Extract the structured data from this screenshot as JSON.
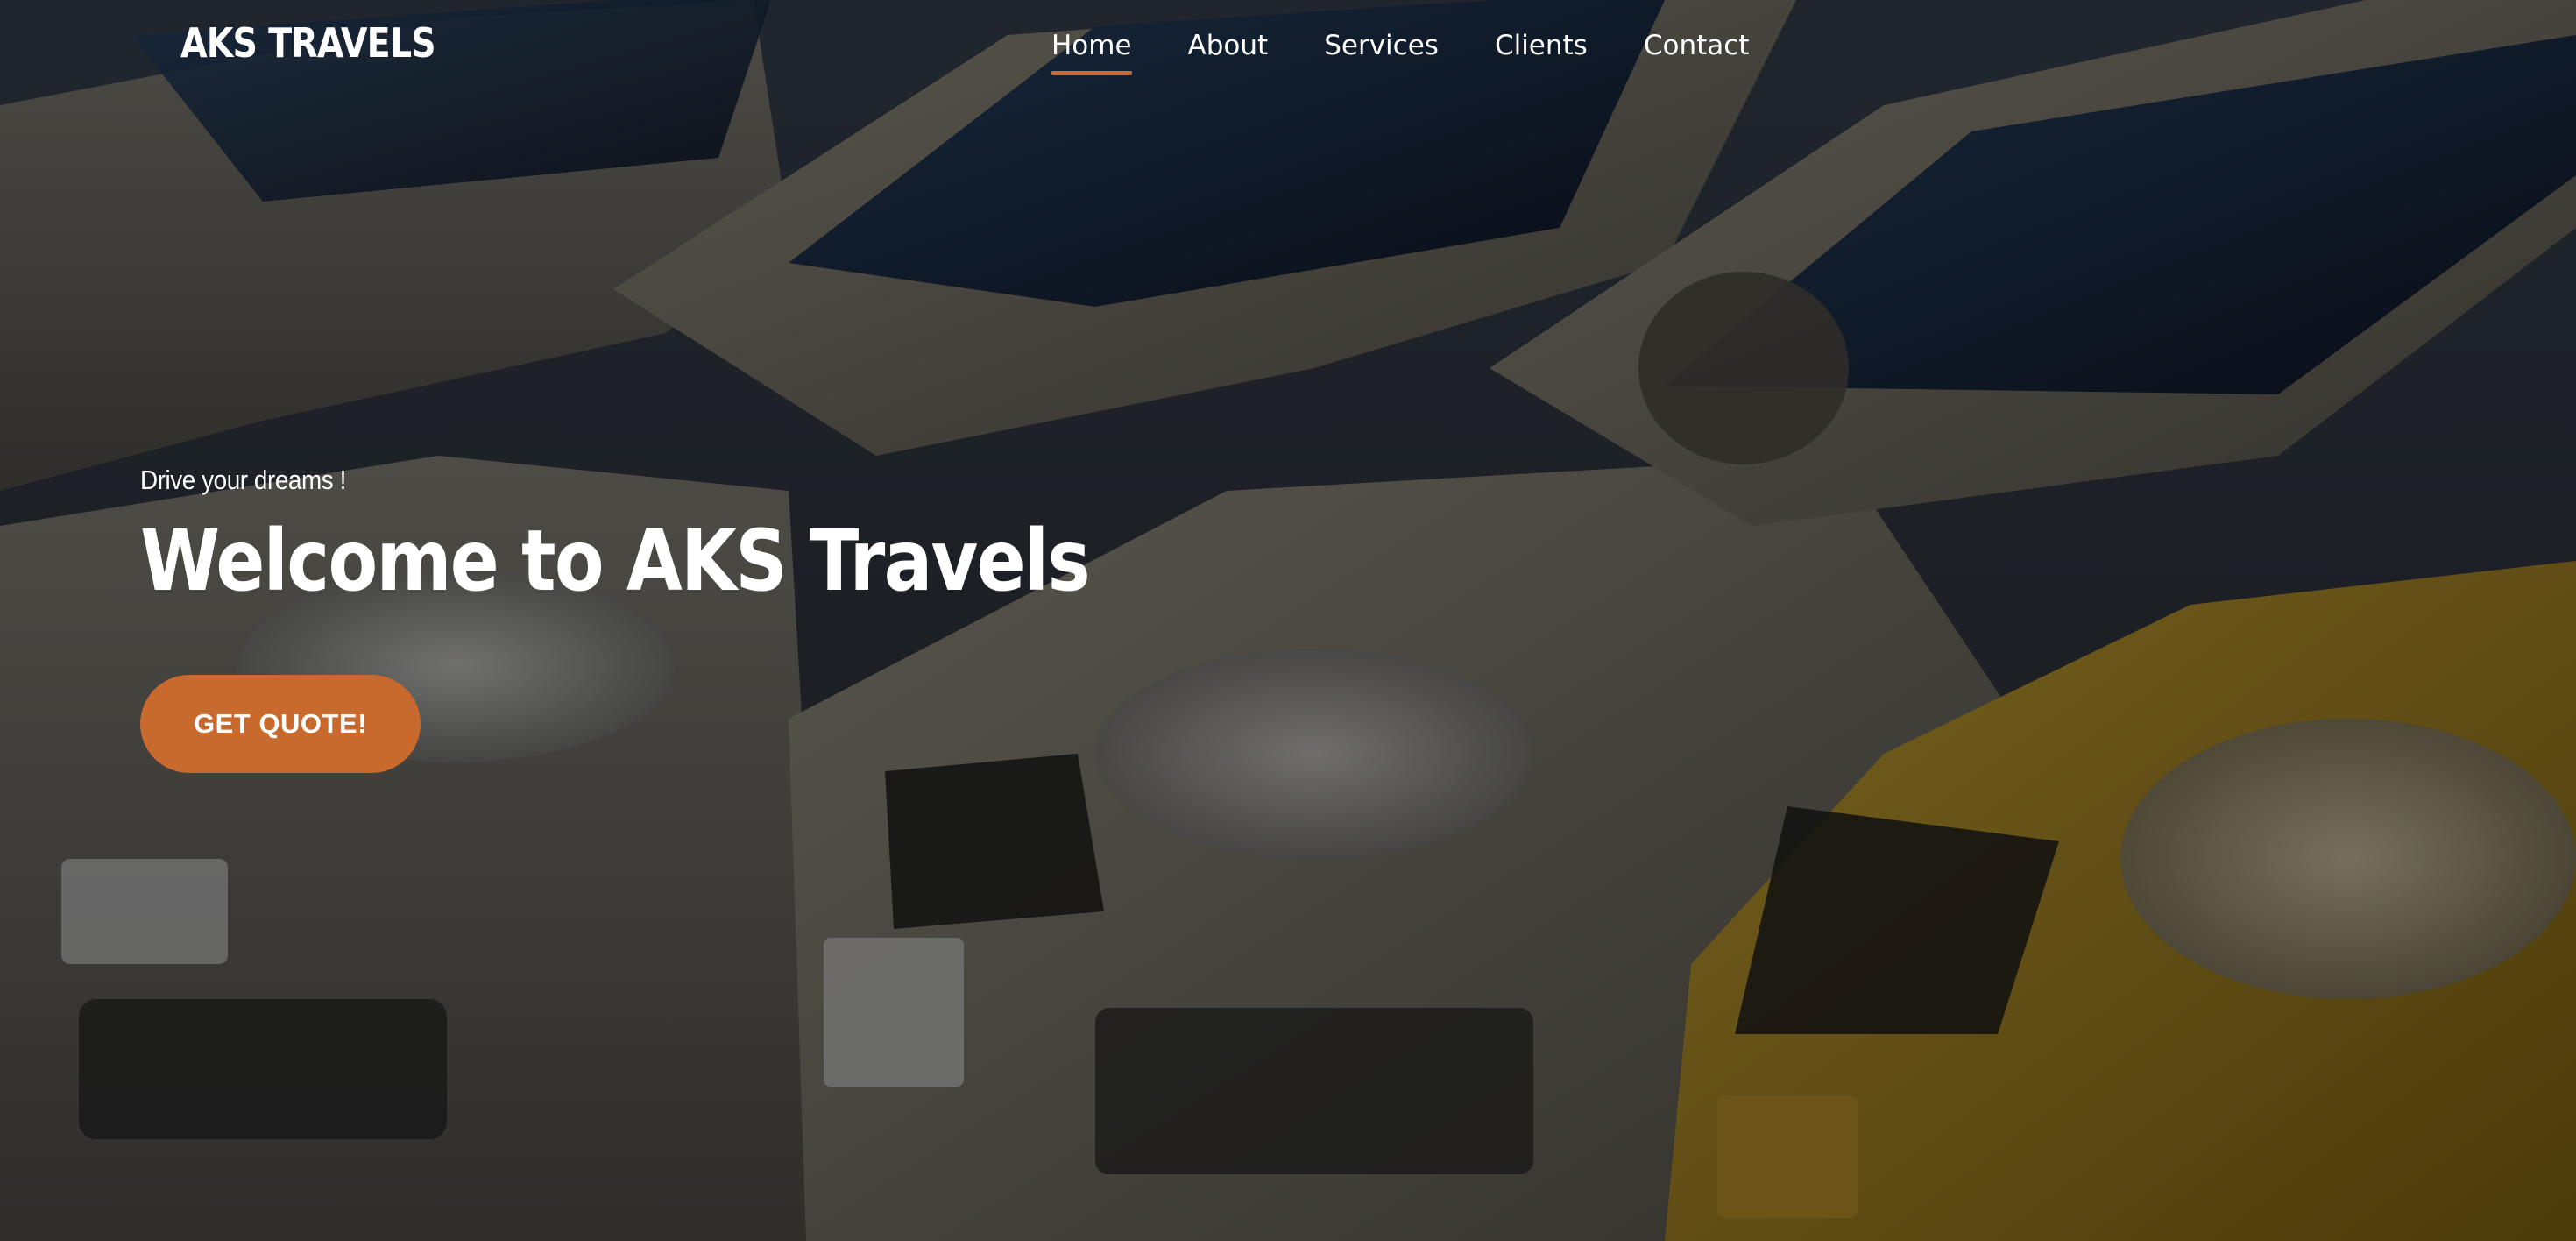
{
  "header": {
    "logo": "AKS TRAVELS",
    "nav": [
      {
        "label": "Home",
        "active": true
      },
      {
        "label": "About",
        "active": false
      },
      {
        "label": "Services",
        "active": false
      },
      {
        "label": "Clients",
        "active": false
      },
      {
        "label": "Contact",
        "active": false
      }
    ]
  },
  "hero": {
    "tagline": "Drive your dreams !",
    "headline": "Welcome to AKS Travels",
    "cta_label": "GET QUOTE!",
    "background_image": "row of parked taxi cars, silver cars and a yellow car"
  },
  "colors": {
    "accent": "#c8692e",
    "text": "#ffffff"
  }
}
